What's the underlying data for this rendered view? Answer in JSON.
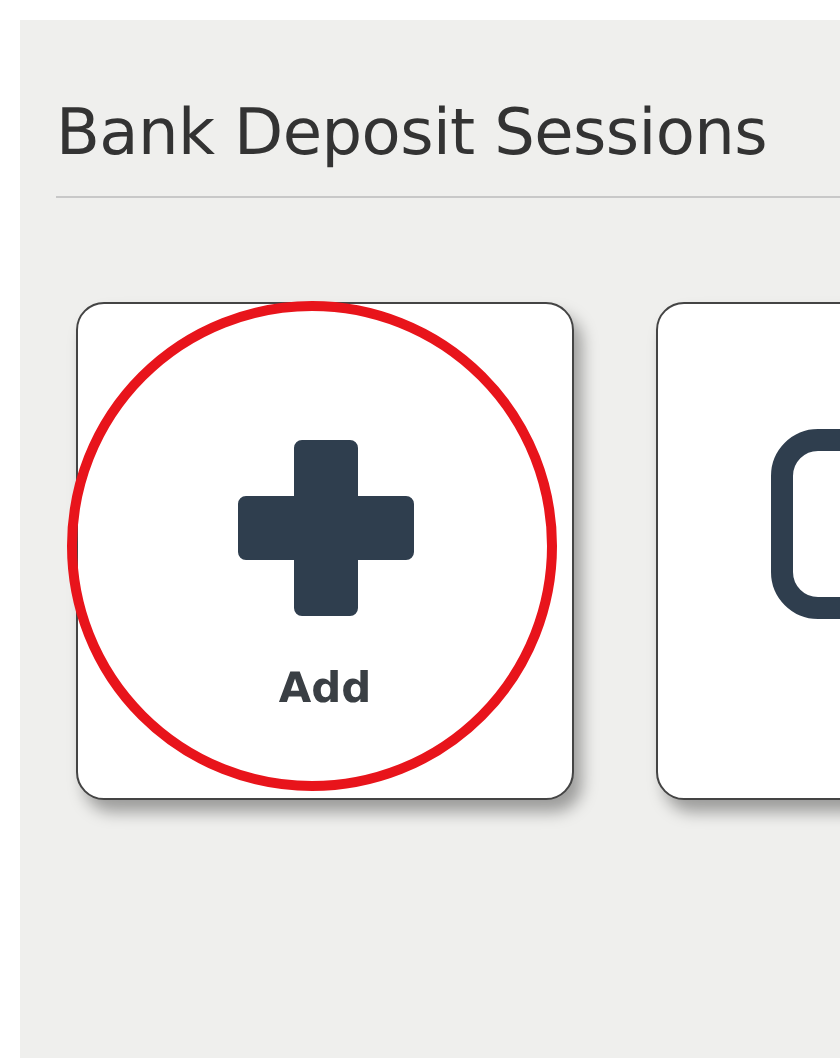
{
  "title": "Bank Deposit Sessions",
  "tiles": [
    {
      "kind": "add",
      "label": "Add",
      "highlighted": true
    },
    {
      "kind": "session",
      "highlighted": false
    }
  ]
}
